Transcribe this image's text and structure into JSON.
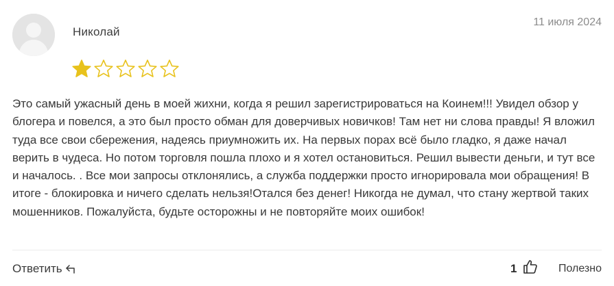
{
  "review": {
    "author": "Николай",
    "date": "11 июля 2024",
    "rating": 1,
    "rating_max": 5,
    "star_color": "#e8c21c",
    "text": "Это самый ужасный день в моей жихни, когда я решил зарегистрироваться на Коинем!!! Увидел обзор у блогера и повелся, а это был просто обман для доверчивых новичков! Там нет ни слова правды! Я вложил туда все свои сбережения, надеясь приумножить их. На первых порах всё было гладко, я даже начал верить в чудеса. Но потом торговля пошла плохо и я хотел остановиться. Решил вывести деньги, и тут все и началось. . Все мои запросы отклонялись, а служба поддержки просто игнорировала мои обращения! В итоге - блокировка и ничего сделать нельзя!Отался без денег! Никогда не думал, что стану жертвой таких мошенников. Пожалуйста, будьте осторожны и не повторяйте моих ошибок!"
  },
  "actions": {
    "reply_label": "Ответить",
    "reply_icon": "reply-arrow-icon",
    "likes_count": "1",
    "like_icon": "thumbs-up-icon",
    "helpful_label": "Полезно"
  }
}
